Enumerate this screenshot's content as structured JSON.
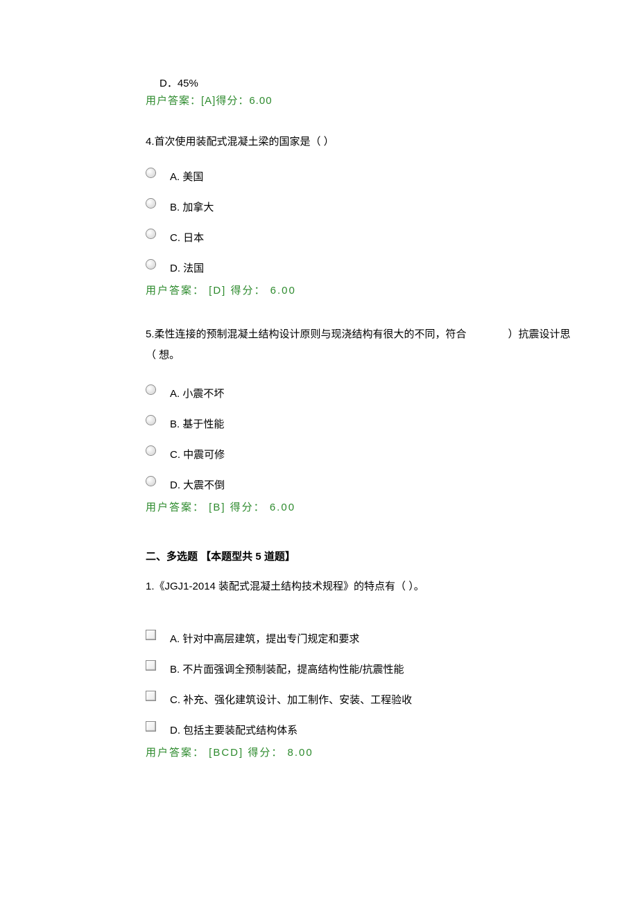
{
  "q3": {
    "optionD": "D．45%",
    "answer": "用户答案：[A]得分：6.00"
  },
  "q4": {
    "stem": "4.首次使用装配式混凝土梁的国家是（ ）",
    "options": {
      "A": "A. 美国",
      "B": "B. 加拿大",
      "C": "C. 日本",
      "D": "D. 法国"
    },
    "answer": "用户答案： [D] 得分：  6.00"
  },
  "q5": {
    "stem": "5.柔性连接的预制混凝土结构设计原则与现浇结构有很大的不同，符合　　　　）抗震设计思 （ 想。",
    "options": {
      "A": "A. 小震不坏",
      "B": "B. 基于性能",
      "C": "C. 中震可修",
      "D": "D. 大震不倒"
    },
    "answer": "用户答案： [B] 得分：  6.00"
  },
  "section2": {
    "title": "二、多选题 【本题型共  5 道题】"
  },
  "m1": {
    "stem": "1.《JGJ1-2014 装配式混凝土结构技术规程》的特点有（ ）。",
    "options": {
      "A": "A. 针对中高层建筑，提出专门规定和要求",
      "B": "B. 不片面强调全预制装配，提高结构性能/抗震性能",
      "C": "C. 补充、强化建筑设计、加工制作、安装、工程验收",
      "D": "D. 包括主要装配式结构体系"
    },
    "answer": "用户答案： [BCD] 得分：  8.00"
  }
}
